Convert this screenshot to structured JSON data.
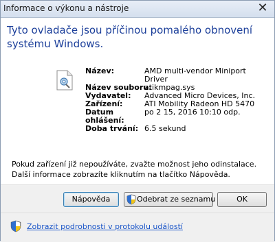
{
  "window": {
    "title": "Informace o výkonu a nástroje",
    "close_glyph": "✕"
  },
  "heading": "Tyto ovladače jsou příčinou pomalého obnovení systému Windows.",
  "file_icon": "driver-file-icon",
  "details": [
    {
      "label": "Název:",
      "value": "AMD multi-vendor Miniport Driver"
    },
    {
      "label": "Název souboru:",
      "value": "atikmpag.sys"
    },
    {
      "label": "Vydavatel:",
      "value": "Advanced Micro Devices, Inc."
    },
    {
      "label": "Zařízení:",
      "value": "ATI Mobility Radeon HD 5470"
    },
    {
      "label": "Datum ohlášení:",
      "value": "po 2 15, 2016 10:10 odp."
    },
    {
      "label": "Doba trvání:",
      "value": "6.5 sekund"
    }
  ],
  "note": "Pokud zařízení již nepoužíváte, zvažte možnost jeho odinstalace. Další informace zobrazíte kliknutím na tlačítko Nápověda.",
  "buttons": {
    "help": "Nápověda",
    "remove": "Odebrat ze seznamu",
    "ok": "OK"
  },
  "footer": {
    "link": "Zobrazit podrobnosti v protokolu událostí",
    "icon": "uac-shield-icon"
  },
  "colors": {
    "heading": "#1c3f9a",
    "link": "#1a55c8"
  }
}
